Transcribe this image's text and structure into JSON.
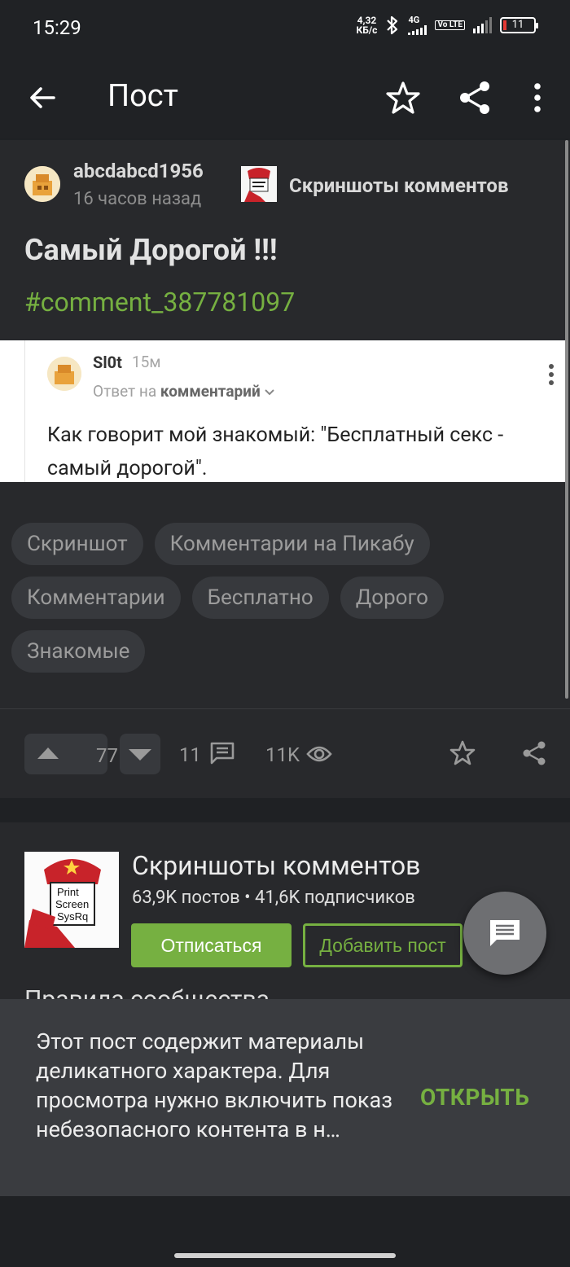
{
  "status": {
    "time": "15:29",
    "speed_value": "4,32",
    "speed_unit": "КБ/с",
    "net1": "4G",
    "volte": "Vo LTE",
    "battery": "11"
  },
  "app_bar": {
    "title": "Пост"
  },
  "post": {
    "author": "abcdabcd1956",
    "time_ago": "16 часов назад",
    "community": "Скриншоты комментов",
    "title": "Самый Дорогой !!!",
    "hashtag": "#comment_387781097"
  },
  "comment_screenshot": {
    "user": "Sl0t",
    "age": "15м",
    "reply_prefix": "Ответ на",
    "reply_target": "комментарий",
    "text": "Как говорит мой знакомый: \"Бесплатный секс - самый дорогой\"."
  },
  "tags": [
    "Скриншот",
    "Комментарии на Пикабу",
    "Комментарии",
    "Бесплатно",
    "Дорого",
    "Знакомые"
  ],
  "actions": {
    "rating": "77",
    "comments": "11",
    "views": "11K"
  },
  "community_card": {
    "name": "Скриншоты комментов",
    "stats": "63,9K постов • 41,6K подписчиков",
    "unsubscribe_label": "Отписаться",
    "add_post_label": "Добавить пост",
    "rules_peek": "Правила сообщества"
  },
  "snackbar": {
    "message": "Этот пост содержит материалы деликатного характера. Для просмотра нужно включить показ небезопасного контента в н…",
    "action": "ОТКРЫТЬ"
  },
  "colors": {
    "accent": "#76b041",
    "background": "#1f2124",
    "card": "#28292c",
    "chip": "#37393d",
    "snackbar": "#3a3c40"
  }
}
